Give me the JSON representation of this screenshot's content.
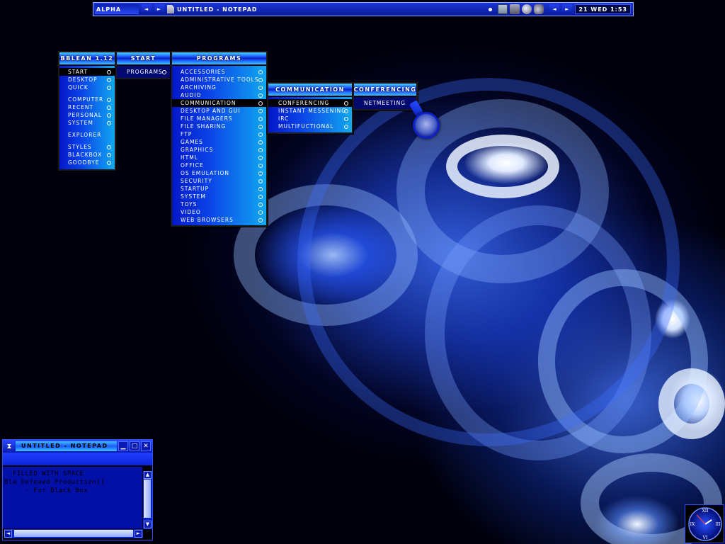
{
  "toolbar": {
    "workspace": "ALPHA",
    "prev_workspace": "◄",
    "next_workspace": "►",
    "task_title": "UNTITLED - NOTEPAD",
    "prev_task": "◄",
    "next_task": "►",
    "clock": "21 WED 1:53"
  },
  "menus": {
    "bblean": {
      "title": "BBLEAN 1.12",
      "items": [
        "START",
        "DESKTOP",
        "QUICK",
        "COMPUTER",
        "RECENT",
        "PERSONAL",
        "SYSTEM",
        "EXPLORER",
        "STYLES",
        "BLACKBOX",
        "GOODBYE"
      ]
    },
    "start": {
      "title": "START",
      "items": [
        "PROGRAMS"
      ]
    },
    "programs": {
      "title": "PROGRAMS",
      "items": [
        "ACCESSORIES",
        "ADMINISTRATIVE TOOLS",
        "ARCHIVING",
        "AUDIO",
        "COMMUNICATION",
        "DESKTOP AND GUI",
        "FILE MANAGERS",
        "FILE SHARING",
        "FTP",
        "GAMES",
        "GRAPHICS",
        "HTML",
        "OFFICE",
        "OS EMULATION",
        "SECURITY",
        "STARTUP",
        "SYSTEM",
        "TOYS",
        "VIDEO",
        "WEB BROWSERS"
      ]
    },
    "communication": {
      "title": "COMMUNICATION",
      "items": [
        "CONFERENCING",
        "INSTANT MESSENING",
        "IRC",
        "MULTIFUCTIONAL"
      ]
    },
    "conferencing": {
      "title": "CONFERENCING",
      "items": [
        "NETMEETING"
      ]
    }
  },
  "notepad": {
    "icon": "⧗",
    "title": "UNTITLED - NOTEPAD",
    "lines": [
      "  FILLED WITH SPACE",
      "Bla Defeaed Production[]",
      "     - For Black Box"
    ],
    "minimize": "▁",
    "maximize": "□",
    "close": "✕",
    "scroll_up": "▲",
    "scroll_down": "▼",
    "scroll_left": "◄",
    "scroll_right": "►"
  },
  "analog_clock": {
    "hour": 1,
    "minute": 53,
    "numerals": [
      "XII",
      "III",
      "VI",
      "IX"
    ]
  },
  "colors": {
    "accent": "#1a3cff",
    "menu_highlight": "#000000",
    "title_gradient_light": "#4fd0ff"
  },
  "icons": {
    "notepad": "hourglass-icon",
    "task": "document-icon",
    "tray": [
      "monitor-icon",
      "network-icon",
      "globe-icon",
      "speaker-icon"
    ]
  }
}
